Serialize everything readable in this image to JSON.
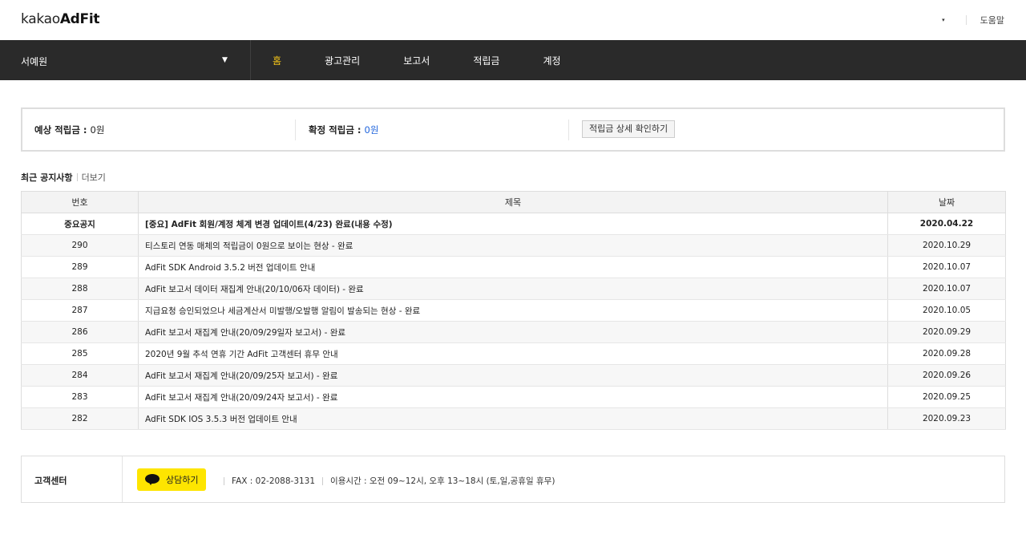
{
  "header": {
    "logo_prefix": "kakao",
    "logo_brand": "AdFit",
    "dropdown_caret": "▾",
    "help_label": "도움말"
  },
  "nav": {
    "account_name": "서예원",
    "account_caret": "▼",
    "items": [
      {
        "label": "홈",
        "active": true
      },
      {
        "label": "광고관리",
        "active": false
      },
      {
        "label": "보고서",
        "active": false
      },
      {
        "label": "적립금",
        "active": false
      },
      {
        "label": "계정",
        "active": false
      }
    ]
  },
  "reward": {
    "expected_label": "예상 적립금 : ",
    "expected_value": "0원",
    "confirmed_label": "확정 적립금 : ",
    "confirmed_value": "0원",
    "detail_button": "적립금 상세 확인하기"
  },
  "notices": {
    "title": "최근 공지사항",
    "more": "더보기",
    "columns": [
      "번호",
      "제목",
      "날짜"
    ],
    "rows": [
      {
        "num": "중요공지",
        "title": "[중요] AdFit 회원/계정 체계 변경 업데이트(4/23) 완료(내용 수정)",
        "date": "2020.04.22",
        "important": true
      },
      {
        "num": "290",
        "title": "티스토리 연동 매체의 적립금이 0원으로 보이는 현상 - 완료",
        "date": "2020.10.29"
      },
      {
        "num": "289",
        "title": "AdFit SDK Android 3.5.2 버전 업데이트 안내",
        "date": "2020.10.07"
      },
      {
        "num": "288",
        "title": "AdFit 보고서 데이터 재집계 안내(20/10/06자 데이터) - 완료",
        "date": "2020.10.07"
      },
      {
        "num": "287",
        "title": "지급요청 승인되었으나 세금계산서 미발행/오발행 알림이 발송되는 현상 - 완료",
        "date": "2020.10.05"
      },
      {
        "num": "286",
        "title": "AdFit 보고서 재집계 안내(20/09/29일자 보고서) - 완료",
        "date": "2020.09.29"
      },
      {
        "num": "285",
        "title": "2020년 9월 추석 연휴 기간 AdFit 고객센터 휴무 안내",
        "date": "2020.09.28"
      },
      {
        "num": "284",
        "title": "AdFit 보고서 재집계 안내(20/09/25자 보고서) - 완료",
        "date": "2020.09.26"
      },
      {
        "num": "283",
        "title": "AdFit 보고서 재집계 안내(20/09/24자 보고서) - 완료",
        "date": "2020.09.25"
      },
      {
        "num": "282",
        "title": "AdFit SDK IOS 3.5.3 버전 업데이트 안내",
        "date": "2020.09.23"
      }
    ]
  },
  "customer_center": {
    "label": "고객센터",
    "chat_button": "상담하기",
    "fax": "FAX : 02-2088-3131",
    "hours": "이용시간 : 오전 09~12시, 오후 13~18시 (토,일,공휴일 휴무)"
  },
  "colors": {
    "nav_bg": "#2a2a2a",
    "nav_active": "#f5c518",
    "kakao_yellow": "#fee500",
    "link_blue": "#2266dd"
  }
}
